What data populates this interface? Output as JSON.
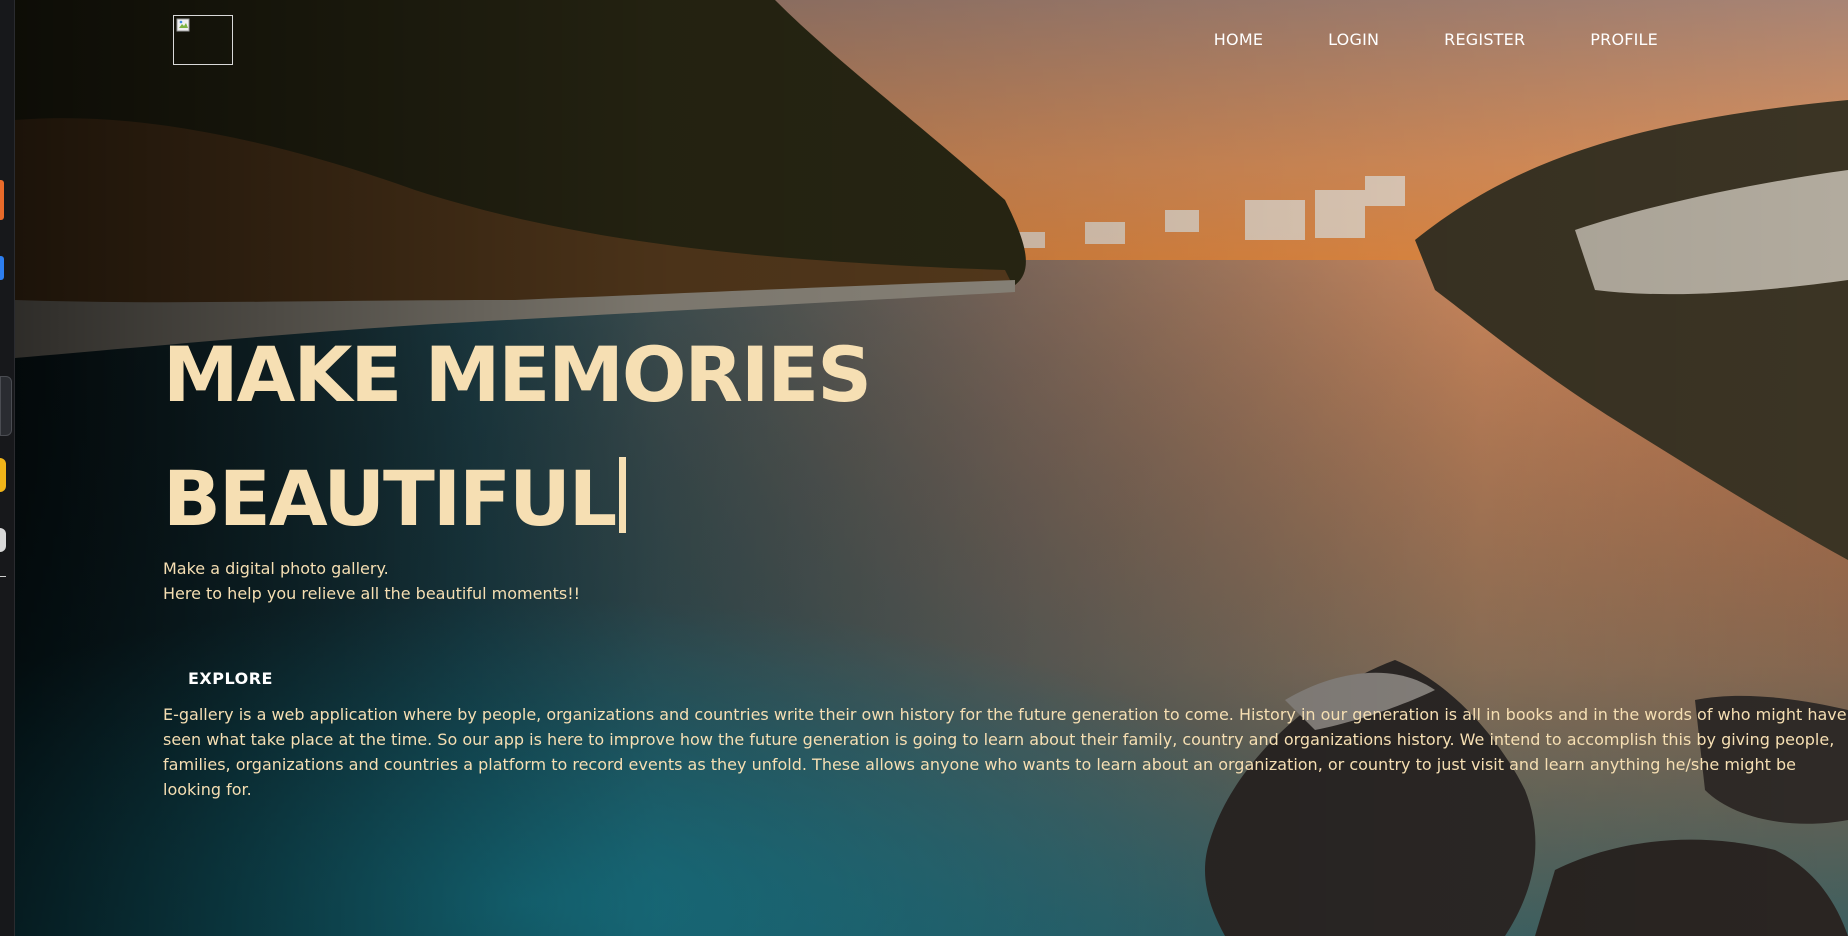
{
  "nav": {
    "logo_alt": "",
    "links": [
      "HOME",
      "LOGIN",
      "REGISTER",
      "PROFILE"
    ]
  },
  "hero": {
    "headline_line1": "MAKE MEMORIES",
    "headline_line2": "BEAUTIFUL",
    "tagline_line1": "Make a digital photo gallery.",
    "tagline_line2": "Here to help you relieve all the beautiful moments!!",
    "explore_label": "EXPLORE",
    "description": "E-gallery is a web application where by people, organizations and countries write their own history for the future generation to come. History in our generation is all in books and in the words of who might have seen what take place at the time. So our app is here to improve how the future generation is going to learn about their family, country and organizations history. We intend to accomplish this by giving people, families, organizations and countries a platform to record events as they unfold. These allows anyone who wants to learn about an organization, or country to just visit and learn anything he/she might be looking for."
  },
  "colors": {
    "headline": "#f6dfb3",
    "sky_top": "#b98a70",
    "sky_glow": "#e98b3c",
    "water_teal": "#1f6e7d",
    "forest": "#2a2a14"
  }
}
